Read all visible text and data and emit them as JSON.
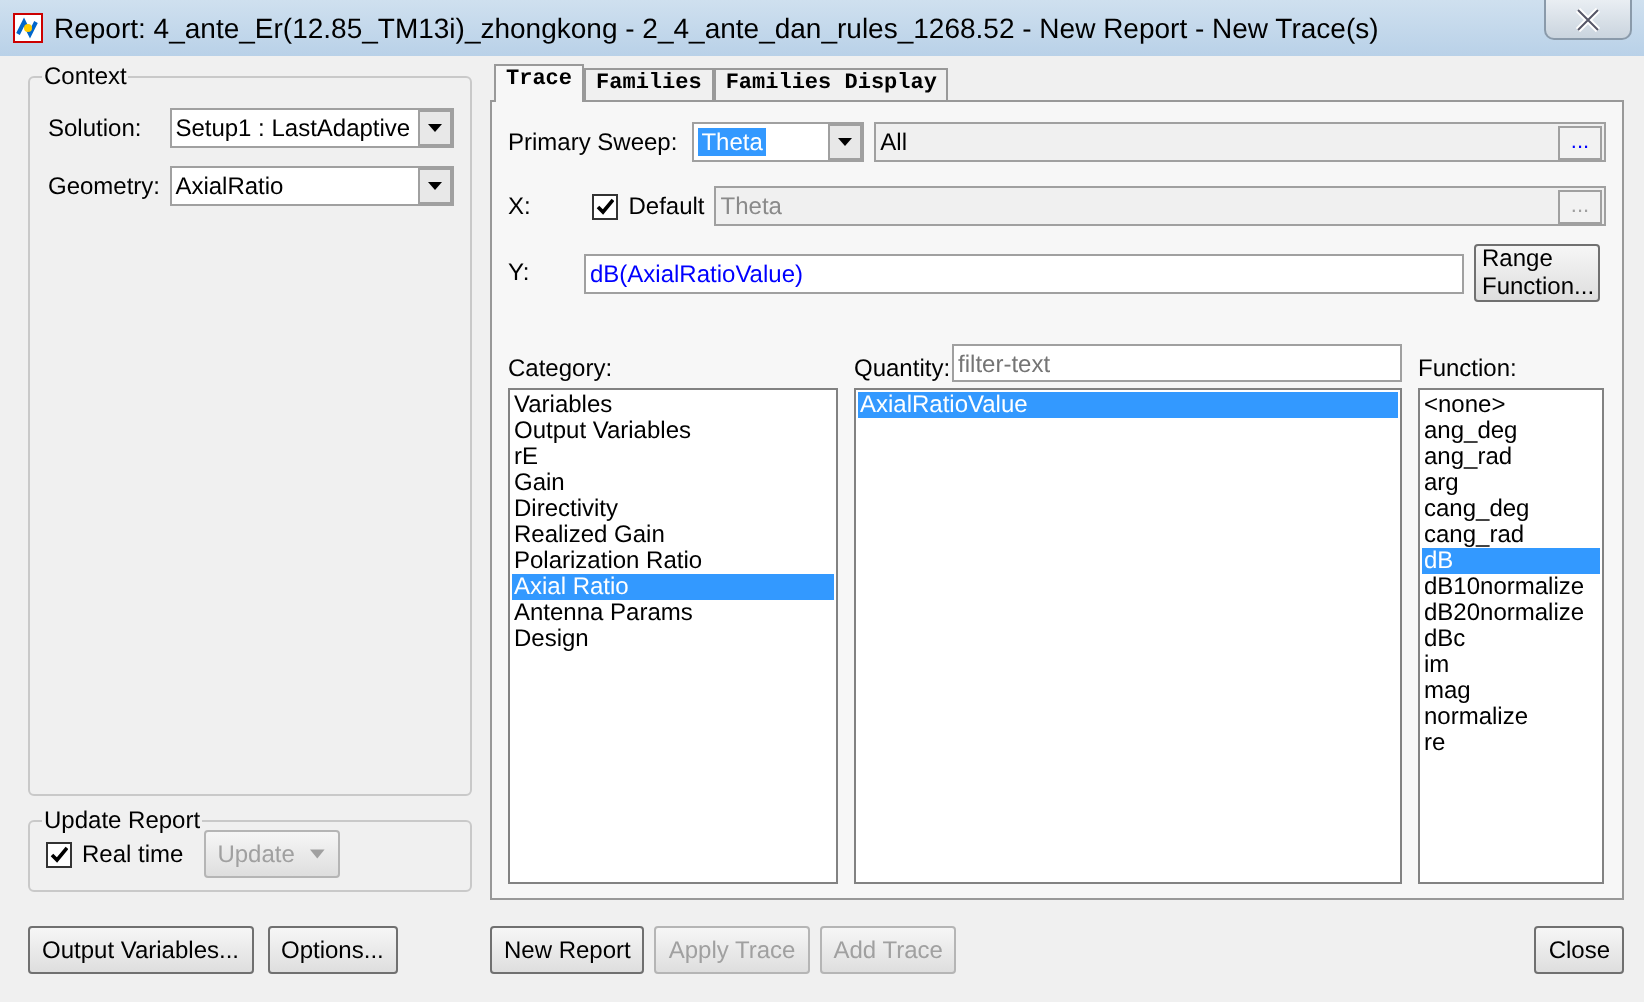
{
  "window": {
    "title": "Report: 4_ante_Er(12.85_TM13i)_zhongkong - 2_4_ante_dan_rules_1268.52 - New Report - New Trace(s)"
  },
  "context": {
    "title": "Context",
    "solution": {
      "label": "Solution:",
      "value": "Setup1 : LastAdaptive"
    },
    "geometry": {
      "label": "Geometry:",
      "value": "AxialRatio"
    }
  },
  "update_report": {
    "title": "Update Report",
    "real_time": {
      "label": "Real time",
      "checked": true
    },
    "update_button": {
      "label": "Update",
      "disabled": true
    }
  },
  "left_buttons": [
    {
      "label": "Output Variables...",
      "disabled": false
    },
    {
      "label": "Options...",
      "disabled": false
    }
  ],
  "tabs": [
    {
      "label": "Trace",
      "selected": true
    },
    {
      "label": "Families",
      "selected": false
    },
    {
      "label": "Families Display",
      "selected": false
    }
  ],
  "primary_sweep": {
    "label": "Primary Sweep:",
    "value": "Theta",
    "values_field": "All",
    "browse": "..."
  },
  "x": {
    "label": "X:",
    "default_label": "Default",
    "default_checked": true,
    "value": "Theta",
    "browse": "..."
  },
  "y": {
    "label": "Y:",
    "value": "dB(AxialRatioValue)",
    "range_button": "Range Function..."
  },
  "category": {
    "label": "Category:",
    "items": [
      {
        "label": "Variables",
        "selected": false
      },
      {
        "label": "Output Variables",
        "selected": false
      },
      {
        "label": "rE",
        "selected": false
      },
      {
        "label": "Gain",
        "selected": false
      },
      {
        "label": "Directivity",
        "selected": false
      },
      {
        "label": "Realized Gain",
        "selected": false
      },
      {
        "label": "Polarization Ratio",
        "selected": false
      },
      {
        "label": "Axial Ratio",
        "selected": true
      },
      {
        "label": "Antenna Params",
        "selected": false
      },
      {
        "label": "Design",
        "selected": false
      }
    ]
  },
  "quantity": {
    "label": "Quantity:",
    "filter_placeholder": "filter-text",
    "items": [
      {
        "label": "AxialRatioValue",
        "selected": true
      }
    ]
  },
  "function": {
    "label": "Function:",
    "items": [
      {
        "label": "<none>",
        "selected": false
      },
      {
        "label": "ang_deg",
        "selected": false
      },
      {
        "label": "ang_rad",
        "selected": false
      },
      {
        "label": "arg",
        "selected": false
      },
      {
        "label": "cang_deg",
        "selected": false
      },
      {
        "label": "cang_rad",
        "selected": false
      },
      {
        "label": "dB",
        "selected": true
      },
      {
        "label": "dB10normalize",
        "selected": false
      },
      {
        "label": "dB20normalize",
        "selected": false
      },
      {
        "label": "dBc",
        "selected": false
      },
      {
        "label": "im",
        "selected": false
      },
      {
        "label": "mag",
        "selected": false
      },
      {
        "label": "normalize",
        "selected": false
      },
      {
        "label": "re",
        "selected": false
      }
    ]
  },
  "bottom_buttons": [
    {
      "label": "New Report",
      "disabled": false
    },
    {
      "label": "Apply Trace",
      "disabled": true
    },
    {
      "label": "Add Trace",
      "disabled": true
    }
  ],
  "close_button": {
    "label": "Close",
    "disabled": false
  }
}
